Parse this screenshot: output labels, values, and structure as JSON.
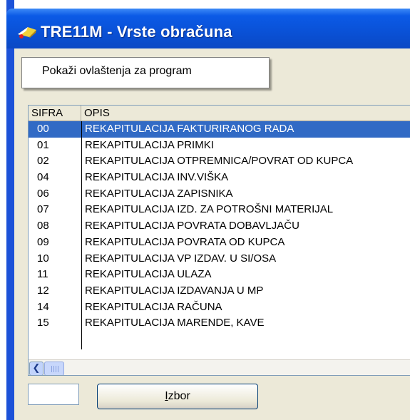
{
  "window": {
    "title": "TRE11M - Vrste obračuna"
  },
  "context_menu": {
    "items": [
      {
        "label": "Pokaži ovlaštenja za program"
      }
    ]
  },
  "grid": {
    "columns": [
      "SIFRA",
      "OPIS"
    ],
    "selected_index": 0,
    "rows": [
      {
        "sifra": "00",
        "opis": "REKAPITULACIJA FAKTURIRANOG RADA"
      },
      {
        "sifra": "01",
        "opis": "REKAPITULACIJA PRIMKI"
      },
      {
        "sifra": "02",
        "opis": "REKAPITULACIJA OTPREMNICA/POVRAT OD KUPCA"
      },
      {
        "sifra": "04",
        "opis": "REKAPITULACIJA INV.VIŠKA"
      },
      {
        "sifra": "06",
        "opis": "REKAPITULACIJA ZAPISNIKA"
      },
      {
        "sifra": "07",
        "opis": "REKAPITULACIJA IZD. ZA POTROŠNI MATERIJAL"
      },
      {
        "sifra": "08",
        "opis": "REKAPITULACIJA POVRATA DOBAVLJAČU"
      },
      {
        "sifra": "09",
        "opis": "REKAPITULACIJA POVRATA OD KUPCA"
      },
      {
        "sifra": "10",
        "opis": "REKAPITULACIJA VP IZDAV. U SI/OSA"
      },
      {
        "sifra": "11",
        "opis": "REKAPITULACIJA ULAZA"
      },
      {
        "sifra": "12",
        "opis": "REKAPITULACIJA IZDAVANJA U MP"
      },
      {
        "sifra": "14",
        "opis": "REKAPITULACIJA RAČUNA"
      },
      {
        "sifra": "15",
        "opis": "REKAPITULACIJA MARENDE, KAVE"
      }
    ]
  },
  "scrollbar": {
    "left_arrow_icon": "chevron-left-icon"
  },
  "input": {
    "value": ""
  },
  "button": {
    "label_underlined": "I",
    "label_rest": "zbor"
  },
  "colors": {
    "titlebar": "#0a51d6",
    "selection": "#316ac5",
    "client_bg": "#ece9d8"
  }
}
